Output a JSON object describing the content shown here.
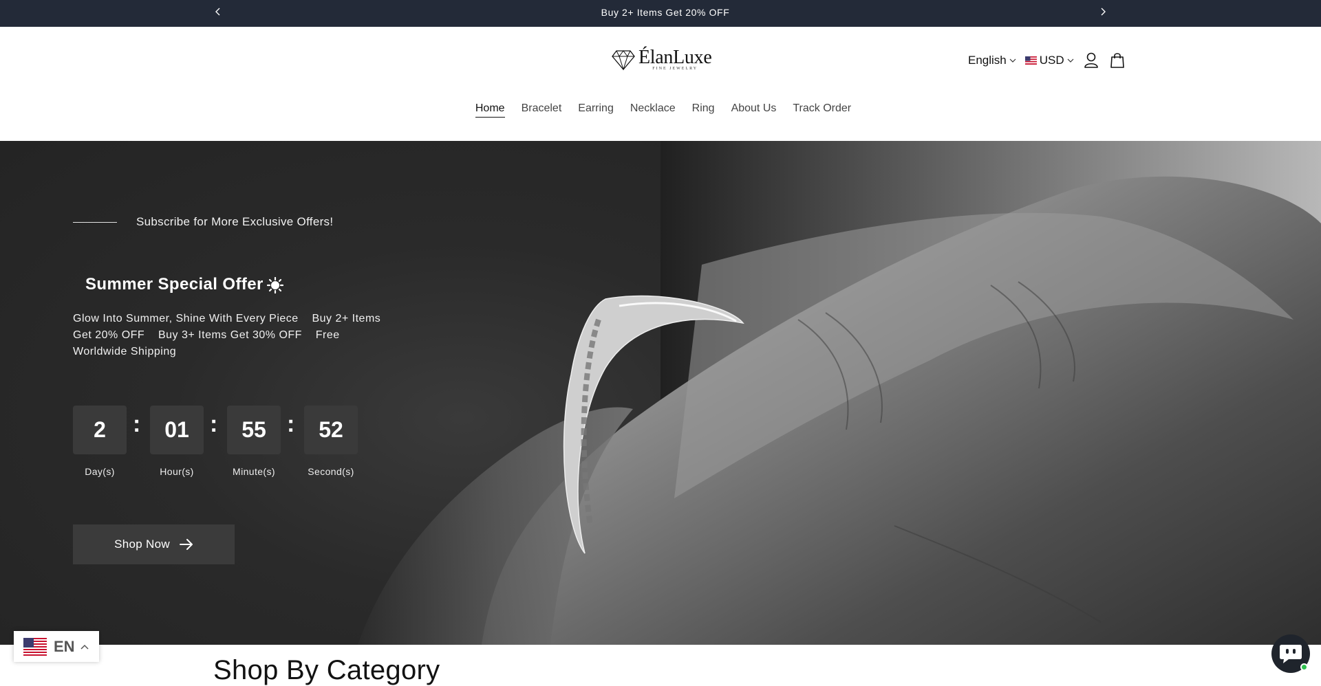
{
  "announcement": {
    "message": "Buy 2+ Items Get 20% OFF",
    "prev_icon": "chevron-left-icon",
    "next_icon": "chevron-right-icon"
  },
  "header": {
    "brand": "ÉlanLuxe",
    "tagline": "FINE JEWELRY",
    "language": "English",
    "currency": "USD",
    "account_icon": "user-icon",
    "cart_icon": "shopping-bag-icon"
  },
  "nav": {
    "items": [
      "Home",
      "Bracelet",
      "Earring",
      "Necklace",
      "Ring",
      "About Us",
      "Track Order"
    ],
    "active": "Home"
  },
  "hero": {
    "subscribe_text": "Subscribe for More Exclusive Offers!",
    "offer_title": "Summer Special Offer",
    "offer_icon": "sun-icon",
    "offer_description": "Glow Into Summer, Shine With Every Piece    Buy 2+ Items Get 20% OFF    Buy 3+ Items Get 30% OFF    Free Worldwide Shipping",
    "countdown": {
      "days": "2",
      "hours": "01",
      "minutes": "55",
      "seconds": "52",
      "days_label": "Day(s)",
      "hours_label": "Hour(s)",
      "minutes_label": "Minute(s)",
      "seconds_label": "Second(s)",
      "separator": ":"
    },
    "cta_label": "Shop Now",
    "cta_icon": "arrow-right-icon"
  },
  "section": {
    "title": "Shop By Category"
  },
  "language_widget": {
    "code": "EN",
    "flag_icon": "us-flag-icon"
  },
  "chat": {
    "icon": "chat-bot-icon",
    "status": "online"
  },
  "colors": {
    "announcement_bg": "#232a38",
    "button_bg": "#3b3b3b",
    "online": "#2ec04f"
  }
}
